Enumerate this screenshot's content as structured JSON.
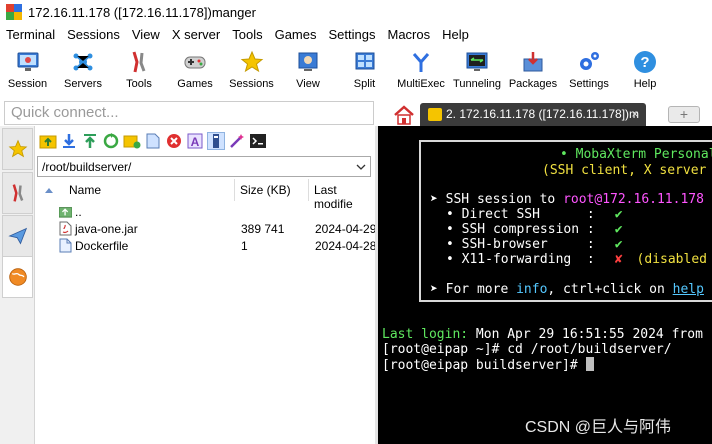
{
  "window": {
    "title": "172.16.11.178 ([172.16.11.178])manger"
  },
  "menu": [
    "Terminal",
    "Sessions",
    "View",
    "X server",
    "Tools",
    "Games",
    "Settings",
    "Macros",
    "Help"
  ],
  "toolbar": [
    {
      "label": "Session",
      "icon": "monitor-icon"
    },
    {
      "label": "Servers",
      "icon": "servers-icon"
    },
    {
      "label": "Tools",
      "icon": "tools-icon"
    },
    {
      "label": "Games",
      "icon": "gamepad-icon"
    },
    {
      "label": "Sessions",
      "icon": "star-icon"
    },
    {
      "label": "View",
      "icon": "view-icon"
    },
    {
      "label": "Split",
      "icon": "split-icon"
    },
    {
      "label": "MultiExec",
      "icon": "fork-icon"
    },
    {
      "label": "Tunneling",
      "icon": "tunnel-icon"
    },
    {
      "label": "Packages",
      "icon": "package-icon"
    },
    {
      "label": "Settings",
      "icon": "gears-icon"
    },
    {
      "label": "Help",
      "icon": "help-icon"
    }
  ],
  "quick_connect": {
    "placeholder": "Quick connect..."
  },
  "tabs": {
    "session_tab_label": "2. 172.16.11.178 ([172.16.11.178])m",
    "close_glyph": "×",
    "new_tab_glyph": "+"
  },
  "file_browser": {
    "path": "/root/buildserver/",
    "columns": {
      "name": "Name",
      "size": "Size (KB)",
      "modified": "Last modifie"
    },
    "rows": [
      {
        "name": "..",
        "size": "",
        "modified": ""
      },
      {
        "name": "java-one.jar",
        "size": "389 741",
        "modified": "2024-04-29"
      },
      {
        "name": "Dockerfile",
        "size": "1",
        "modified": "2024-04-28"
      }
    ]
  },
  "terminal": {
    "banner_title": "• MobaXterm Personal",
    "banner_subtitle": "(SSH client, X server",
    "ssh_prefix": "➤ SSH session to ",
    "ssh_target": "root@172.16.11.178",
    "features": [
      {
        "label": "• Direct SSH      :",
        "status": "✔",
        "note": ""
      },
      {
        "label": "• SSH compression :",
        "status": "✔",
        "note": ""
      },
      {
        "label": "• SSH-browser     :",
        "status": "✔",
        "note": ""
      },
      {
        "label": "• X11-forwarding  :",
        "status": "✘",
        "note": "(disabled"
      }
    ],
    "more_prefix": "➤ For more ",
    "more_info": "info",
    "more_mid": ", ctrl+click on ",
    "more_help": "help",
    "last_login_label": "Last login:",
    "last_login_value": " Mon Apr 29 16:51:55 2024 from",
    "line1": "[root@eipap ~]# cd /root/buildserver/",
    "line2": "[root@eipap buildserver]# "
  },
  "watermark": "CSDN @巨人与阿伟"
}
